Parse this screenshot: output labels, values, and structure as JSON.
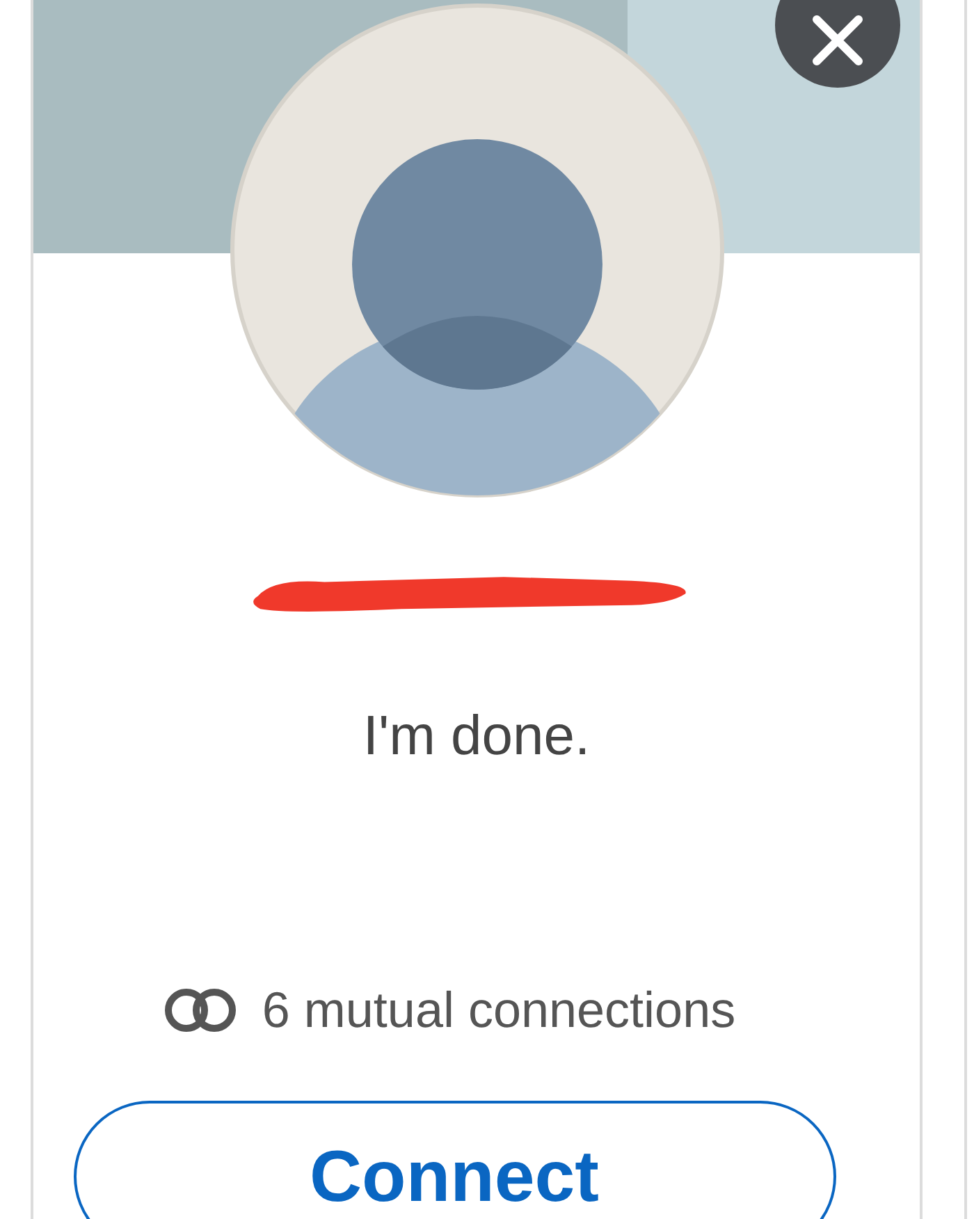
{
  "profile_card": {
    "headline": "I'm done.",
    "mutual_connections": "6 mutual connections",
    "connect_button": "Connect"
  }
}
